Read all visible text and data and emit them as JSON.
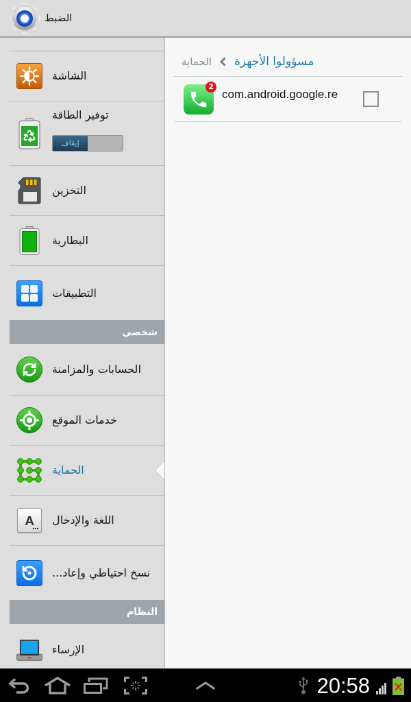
{
  "title_bar": {
    "title": "الضبط"
  },
  "sidebar": {
    "items": [
      {
        "kind": "item",
        "label": "الشاشة",
        "selected": false
      },
      {
        "kind": "switch_item",
        "label": "توفير الطاقة",
        "selected": false,
        "switch": {
          "label": "إيقاف",
          "on": false
        }
      },
      {
        "kind": "item",
        "label": "التخزين",
        "selected": false
      },
      {
        "kind": "item",
        "label": "البطارية",
        "selected": false
      },
      {
        "kind": "item",
        "label": "التطبيقات",
        "selected": false
      },
      {
        "kind": "header",
        "label": "شخصي"
      },
      {
        "kind": "item",
        "label": "الحسابات والمزامنة",
        "selected": false
      },
      {
        "kind": "item",
        "label": "خدمات الموقع",
        "selected": false
      },
      {
        "kind": "item",
        "label": "الحماية",
        "selected": true
      },
      {
        "kind": "key_item",
        "label": "اللغة والإدخال",
        "selected": false,
        "key_letter": "A"
      },
      {
        "kind": "item",
        "label": "نسخ احتياطي وإعاد...",
        "selected": false
      },
      {
        "kind": "header",
        "label": "النظام"
      },
      {
        "kind": "item",
        "label": "الإرساء",
        "selected": false
      }
    ]
  },
  "breadcrumb": {
    "parent": "الحماية",
    "current": "مسؤولوا الأجهزة"
  },
  "device_admins": [
    {
      "name": "com.android.google.re",
      "badge": "2",
      "checked": false
    }
  ],
  "status_bar": {
    "time": "20:58"
  }
}
